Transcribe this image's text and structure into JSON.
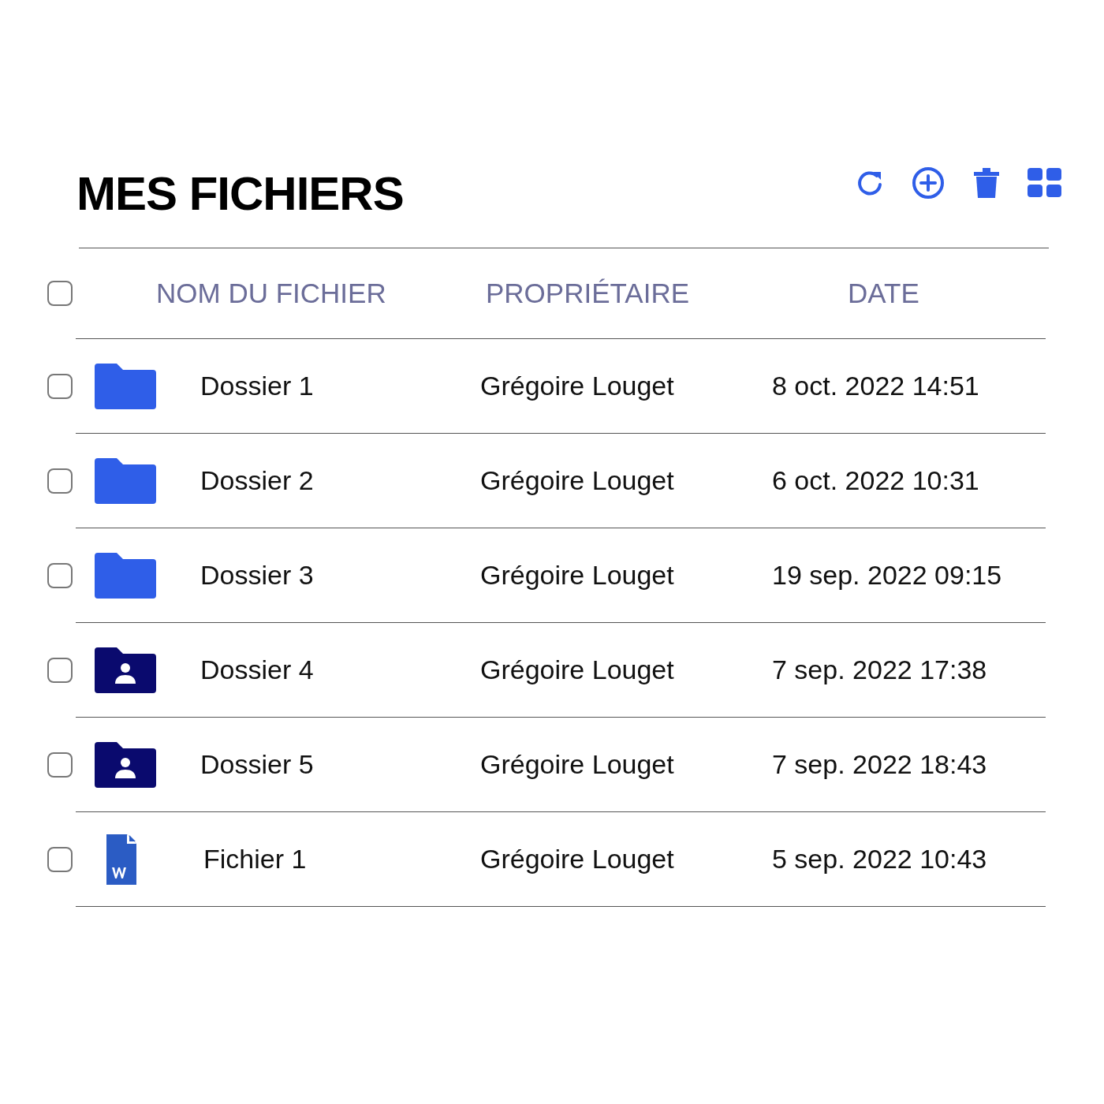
{
  "title": "MES FICHIERS",
  "toolbar": [
    {
      "kind": "refresh"
    },
    {
      "kind": "add"
    },
    {
      "kind": "delete"
    },
    {
      "kind": "grid"
    }
  ],
  "table": {
    "select_all": {
      "checked": false
    },
    "columns": [
      "NOM DU FICHIER",
      "PROPRIÉTAIRE",
      "DATE"
    ],
    "rows": [
      {
        "kind": "folder",
        "checked": false,
        "name": "Dossier 1",
        "owner": "Grégoire Louget",
        "date": "8 oct. 2022 14:51"
      },
      {
        "kind": "folder",
        "checked": false,
        "name": "Dossier 2",
        "owner": "Grégoire Louget",
        "date": "6 oct. 2022 10:31"
      },
      {
        "kind": "folder",
        "checked": false,
        "name": "Dossier 3",
        "owner": "Grégoire Louget",
        "date": "19 sep. 2022 09:15"
      },
      {
        "kind": "shared-folder",
        "checked": false,
        "name": "Dossier 4",
        "owner": "Grégoire Louget",
        "date": "7 sep. 2022 17:38"
      },
      {
        "kind": "shared-folder",
        "checked": false,
        "name": "Dossier 5",
        "owner": "Grégoire Louget",
        "date": "7 sep. 2022 18:43"
      },
      {
        "kind": "word-file",
        "checked": false,
        "name": "Fichier 1",
        "owner": "Grégoire Louget",
        "date": "5 sep. 2022 10:43"
      }
    ]
  }
}
